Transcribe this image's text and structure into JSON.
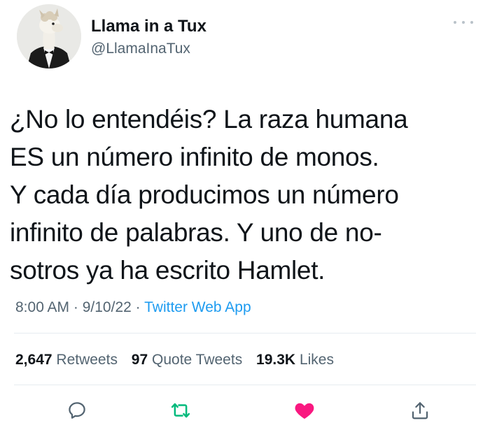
{
  "author": {
    "display_name": "Llama in a Tux",
    "handle": "@LlamaInaTux",
    "avatar_icon": "llama-in-tuxedo-avatar"
  },
  "tweet": {
    "text_lines": [
      "¿No lo entendéis? La raza humana",
      "ES un número infinito de monos.",
      "Y cada día producimos un número",
      "infinito de palabras. Y uno de no-",
      "sotros ya ha escrito Hamlet."
    ]
  },
  "meta": {
    "time": "8:00 AM",
    "separator": " · ",
    "date": "9/10/22",
    "source": "Twitter Web App"
  },
  "stats": {
    "retweets_count": "2,647",
    "retweets_label": "Retweets",
    "quotes_count": "97",
    "quotes_label": "Quote Tweets",
    "likes_count": "19.3K",
    "likes_label": "Likes"
  },
  "actions": {
    "reply_icon": "reply-icon",
    "retweet_icon": "retweet-icon",
    "like_icon": "heart-icon",
    "share_icon": "share-icon"
  },
  "colors": {
    "text_primary": "#0f1419",
    "text_secondary": "#536471",
    "link_blue": "#1d9bf0",
    "retweet_green": "#00ba7c",
    "like_pink": "#f91880",
    "divider": "#e6ecf0"
  }
}
